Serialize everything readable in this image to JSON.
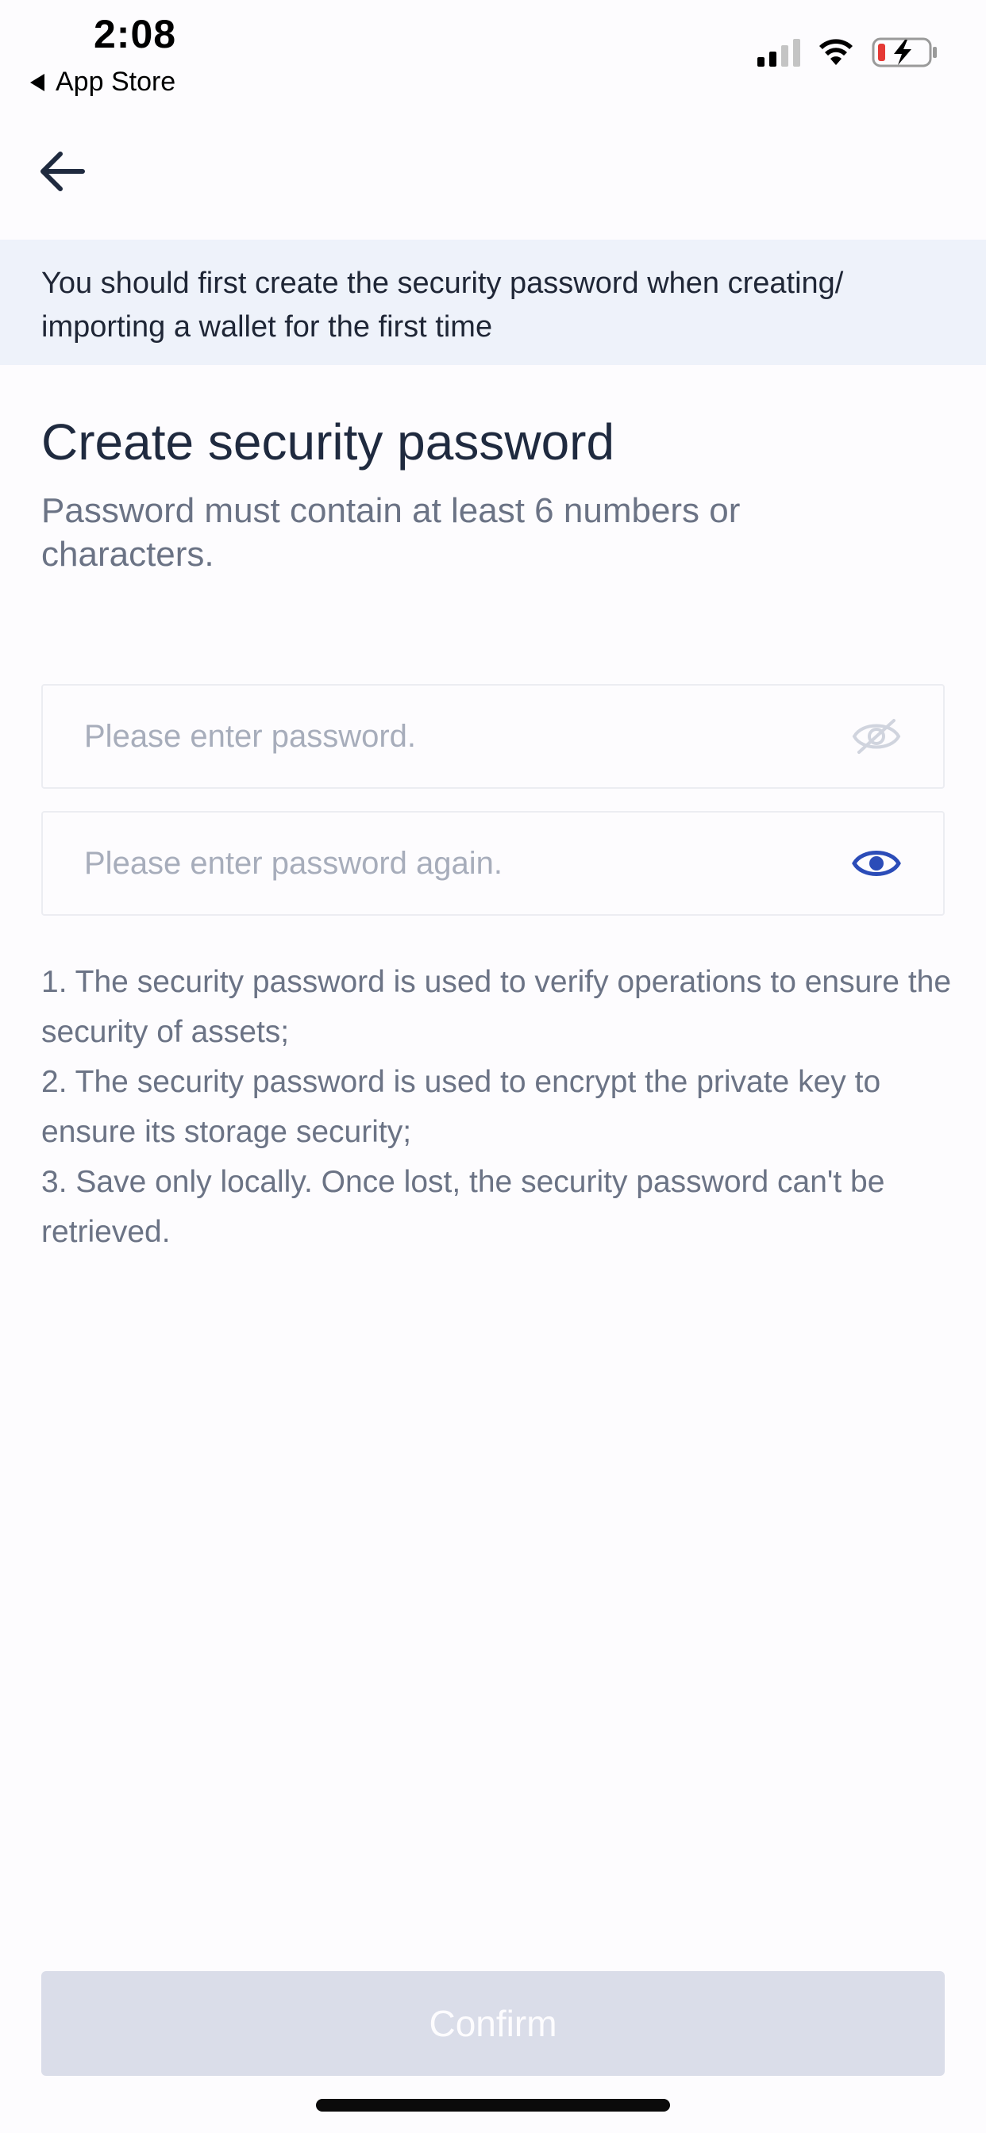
{
  "status_bar": {
    "time": "2:08",
    "back_app": "App Store"
  },
  "nav": {
    "back_icon": "arrow-left-icon"
  },
  "banner": {
    "text": "You should first create the security password when creating/ importing a wallet for the first time"
  },
  "title": "Create security password",
  "subtitle": "Password must contain at least 6 numbers or characters.",
  "fields": {
    "password": {
      "value": "",
      "placeholder": "Please enter password.",
      "icon": "eye-off-icon"
    },
    "password_again": {
      "value": "",
      "placeholder": "Please enter password again.",
      "icon": "eye-icon"
    }
  },
  "notes": [
    "1. The security password is used to verify operations to ensure the security of assets;",
    "2. The security password is used to encrypt the private key to ensure its storage security;",
    "3. Save only locally. Once lost, the security password can't be retrieved."
  ],
  "confirm_label": "Confirm",
  "colors": {
    "accent": "#2b4cb8",
    "banner_bg": "#eef2fa",
    "button_disabled": "#dadde9",
    "battery_low": "#e53935"
  }
}
